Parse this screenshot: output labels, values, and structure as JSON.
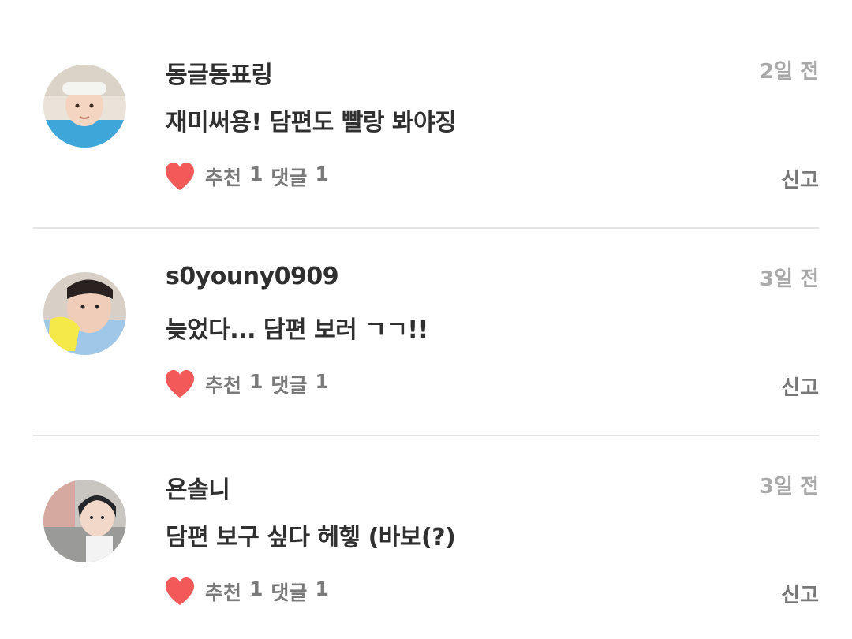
{
  "comments": [
    {
      "username": "동글동표링",
      "time": "2일 전",
      "text": "재미써용! 담편도 빨랑 봐야징",
      "like_label": "추천",
      "like_count": "1",
      "reply_label": "댓글",
      "reply_count": "1",
      "report_label": "신고"
    },
    {
      "username": "s0youny0909",
      "time": "3일 전",
      "text": "늦었다... 담편 보러 ㄱㄱ!!",
      "like_label": "추천",
      "like_count": "1",
      "reply_label": "댓글",
      "reply_count": "1",
      "report_label": "신고"
    },
    {
      "username": "욘솔니",
      "time": "3일 전",
      "text": "담편 보구 싶다 헤헿 (바보(?)",
      "like_label": "추천",
      "like_count": "1",
      "reply_label": "댓글",
      "reply_count": "1",
      "report_label": "신고"
    }
  ],
  "icons": {
    "like": "heart-icon"
  },
  "colors": {
    "heart": "#f25a5a",
    "timestamp": "#a9a9a9",
    "divider": "#e4e4e4"
  }
}
